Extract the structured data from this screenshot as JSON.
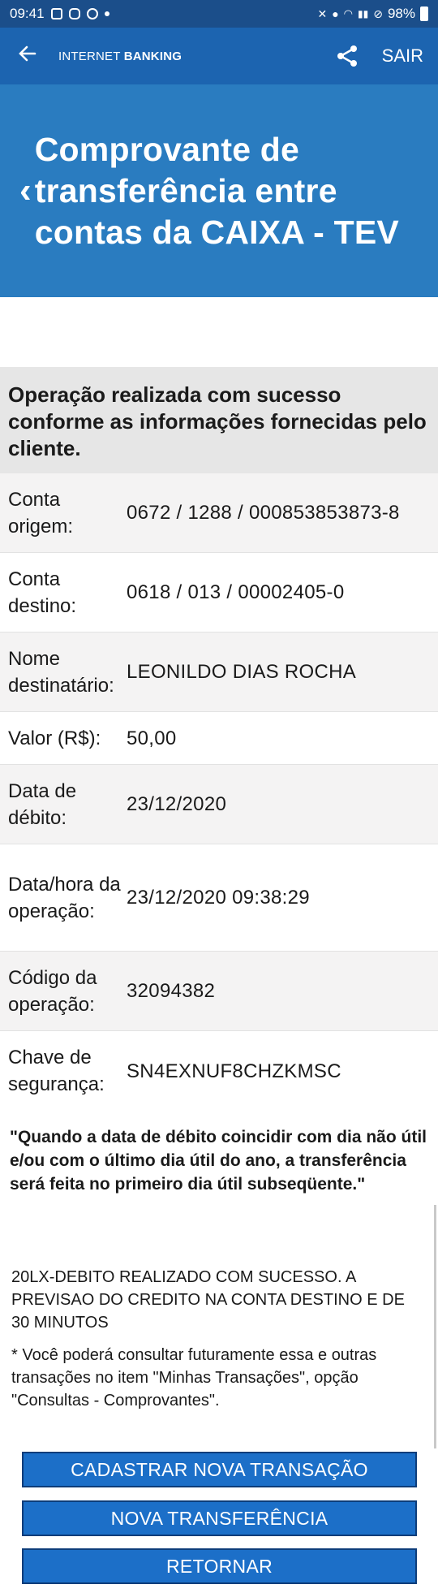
{
  "status": {
    "time": "09:41",
    "battery": "98%"
  },
  "appbar": {
    "brand_light": "INTERNET ",
    "brand_bold": "BANKING",
    "exit_label": "SAIR"
  },
  "title": "Comprovante de transferência entre contas da CAIXA - TEV",
  "success_message": "Operação realizada com sucesso conforme as informações fornecidas pelo cliente.",
  "details": [
    {
      "label": "Conta origem:",
      "value": "0672 / 1288 / 000853853873-8"
    },
    {
      "label": "Conta destino:",
      "value": "0618 / 013 / 00002405-0"
    },
    {
      "label": "Nome destinatário:",
      "value": "LEONILDO DIAS ROCHA"
    },
    {
      "label": "Valor (R$):",
      "value": "50,00"
    },
    {
      "label": "Data de débito:",
      "value": "23/12/2020"
    },
    {
      "label": "Data/hora da operação:",
      "value": "23/12/2020 09:38:29"
    },
    {
      "label": "Código da operação:",
      "value": "32094382"
    },
    {
      "label": "Chave de segurança:",
      "value": "SN4EXNUF8CHZKMSC"
    }
  ],
  "notice": "\"Quando a data de débito coincidir com dia não útil e/ou com o último dia útil do ano, a transferência será feita no primeiro dia útil subseqüente.\"",
  "credit_message": "20LX-DEBITO REALIZADO COM SUCESSO. A PREVISAO DO CREDITO NA CONTA DESTINO E DE 30 MINUTOS",
  "consult_message": "* Você poderá consultar futuramente essa e outras transações no item \"Minhas Transações\", opção \"Consultas - Comprovantes\".",
  "buttons": {
    "new_transaction": "CADASTRAR NOVA TRANSAÇÃO",
    "new_transfer": "NOVA TRANSFERÊNCIA",
    "back": "RETORNAR"
  }
}
